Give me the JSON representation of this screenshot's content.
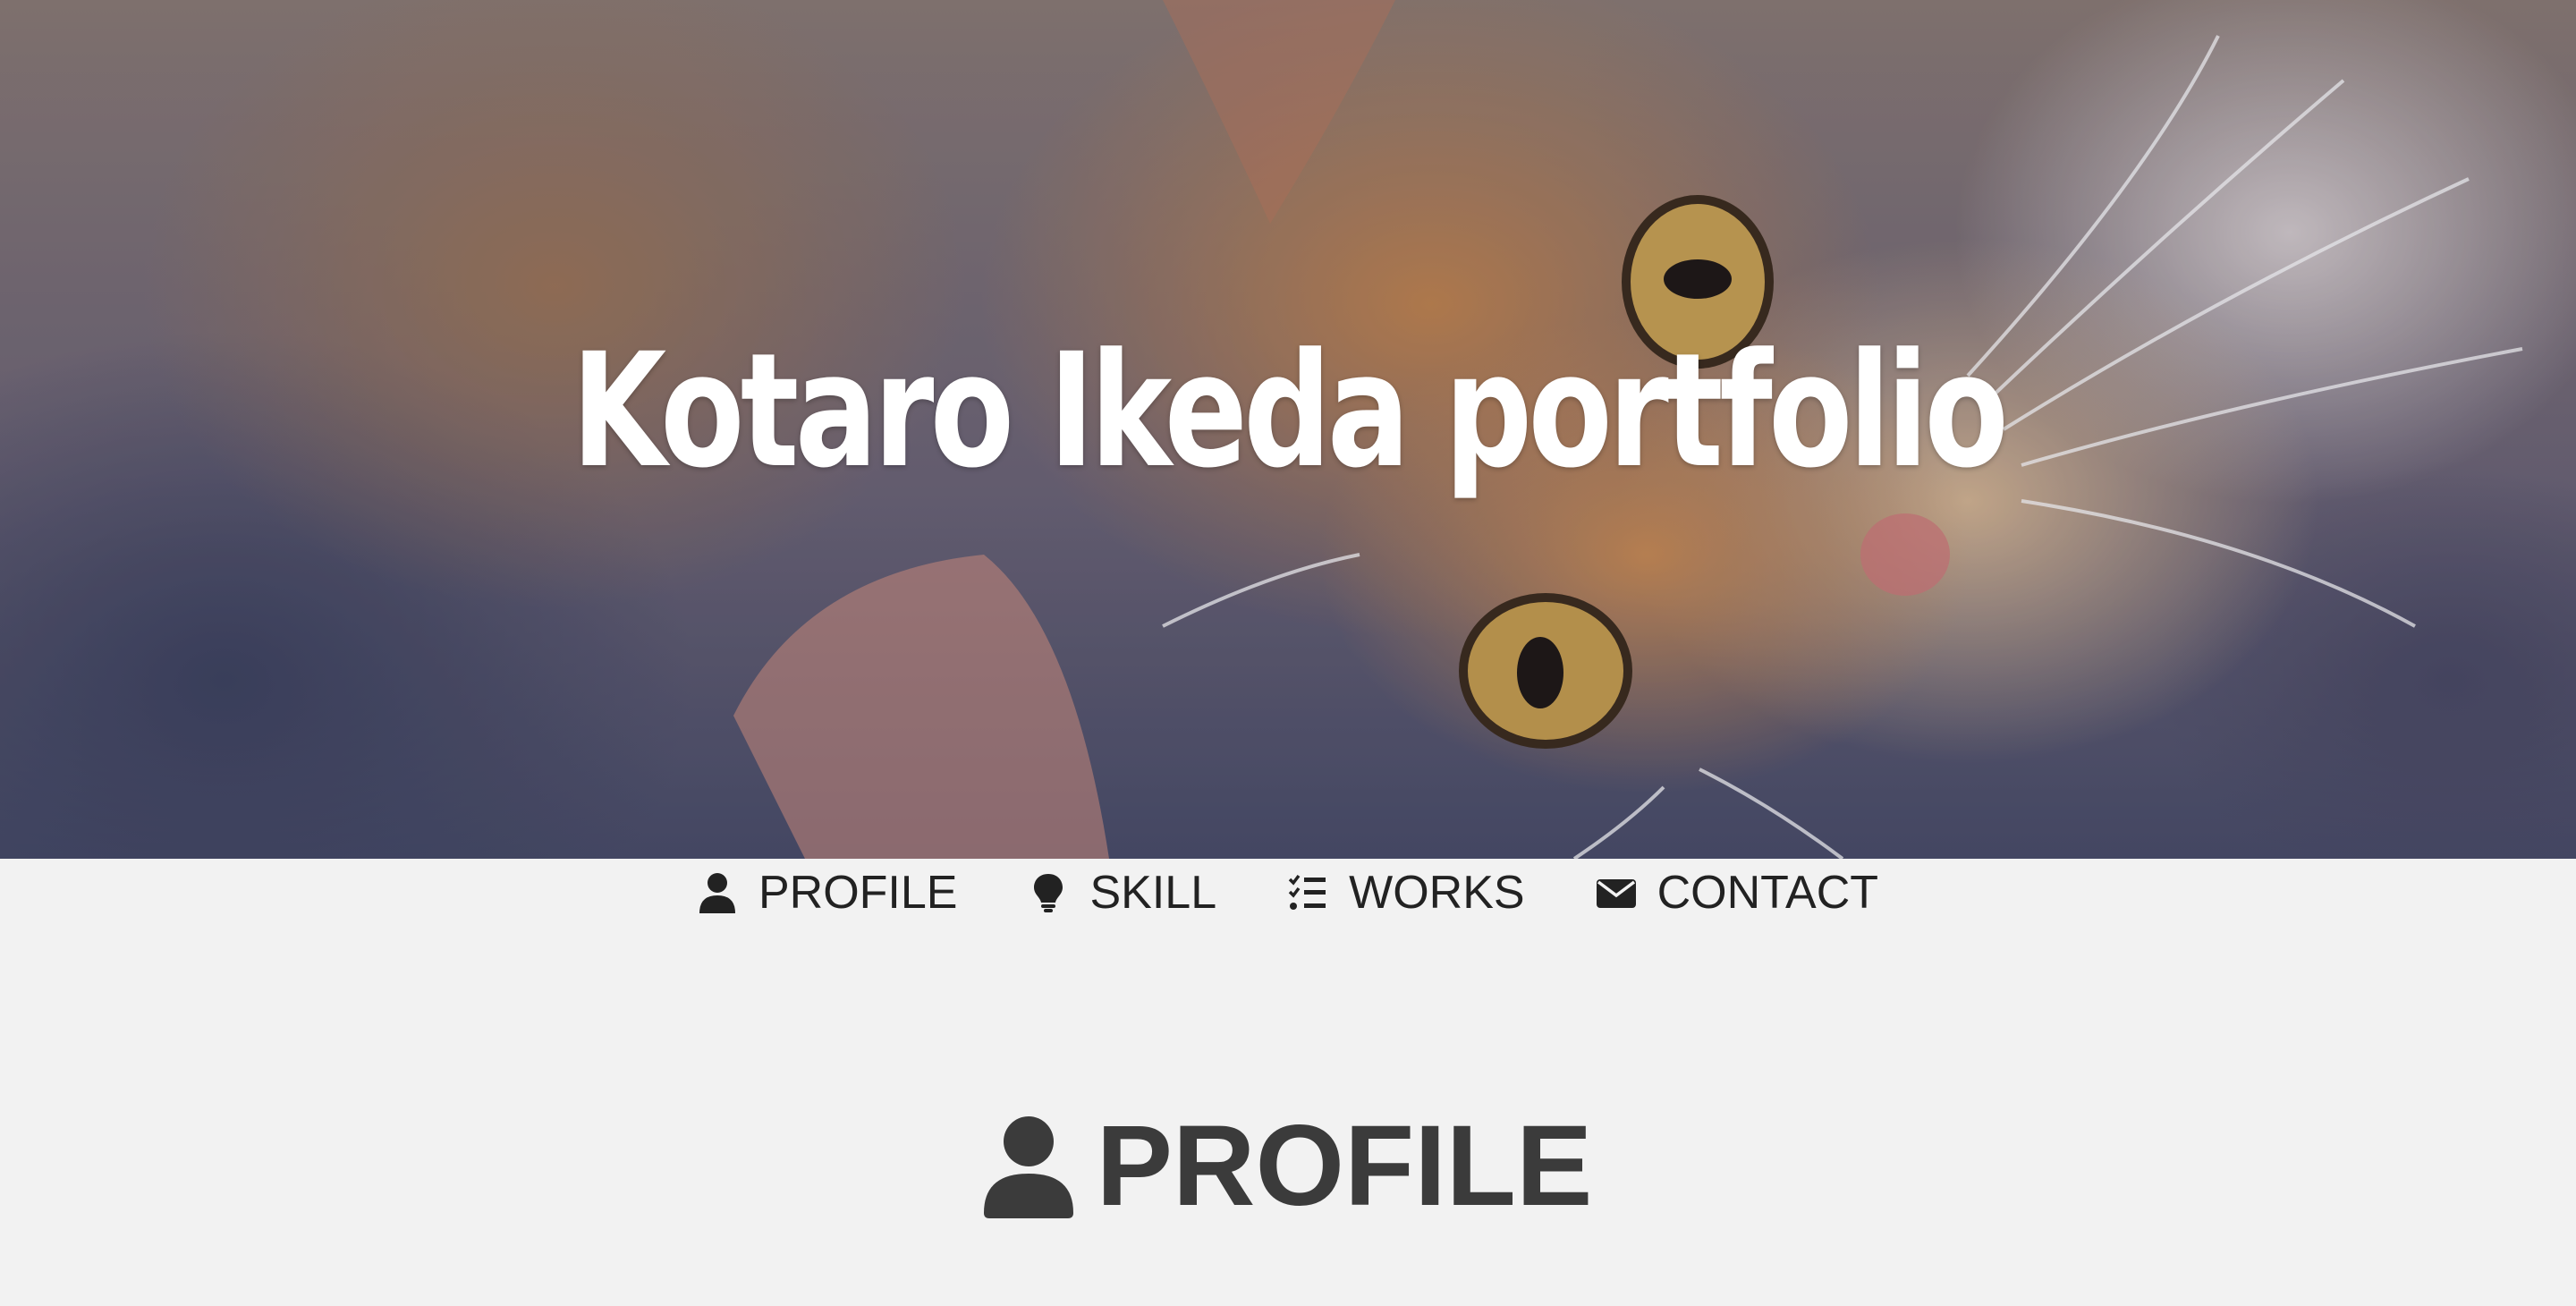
{
  "hero": {
    "title": "Kotaro Ikeda portfolio",
    "background_image": "orange-tabby-cat-photo"
  },
  "nav": {
    "items": [
      {
        "label": "PROFILE",
        "icon": "user-icon"
      },
      {
        "label": "SKILL",
        "icon": "lightbulb-icon"
      },
      {
        "label": "WORKS",
        "icon": "tasks-list-icon"
      },
      {
        "label": "CONTACT",
        "icon": "envelope-icon"
      }
    ]
  },
  "section": {
    "title": "PROFILE",
    "icon": "user-icon"
  },
  "colors": {
    "page_background": "#f2f2f2",
    "nav_text": "#222222",
    "heading_text": "#3b3b3b",
    "hero_title": "#ffffff"
  }
}
